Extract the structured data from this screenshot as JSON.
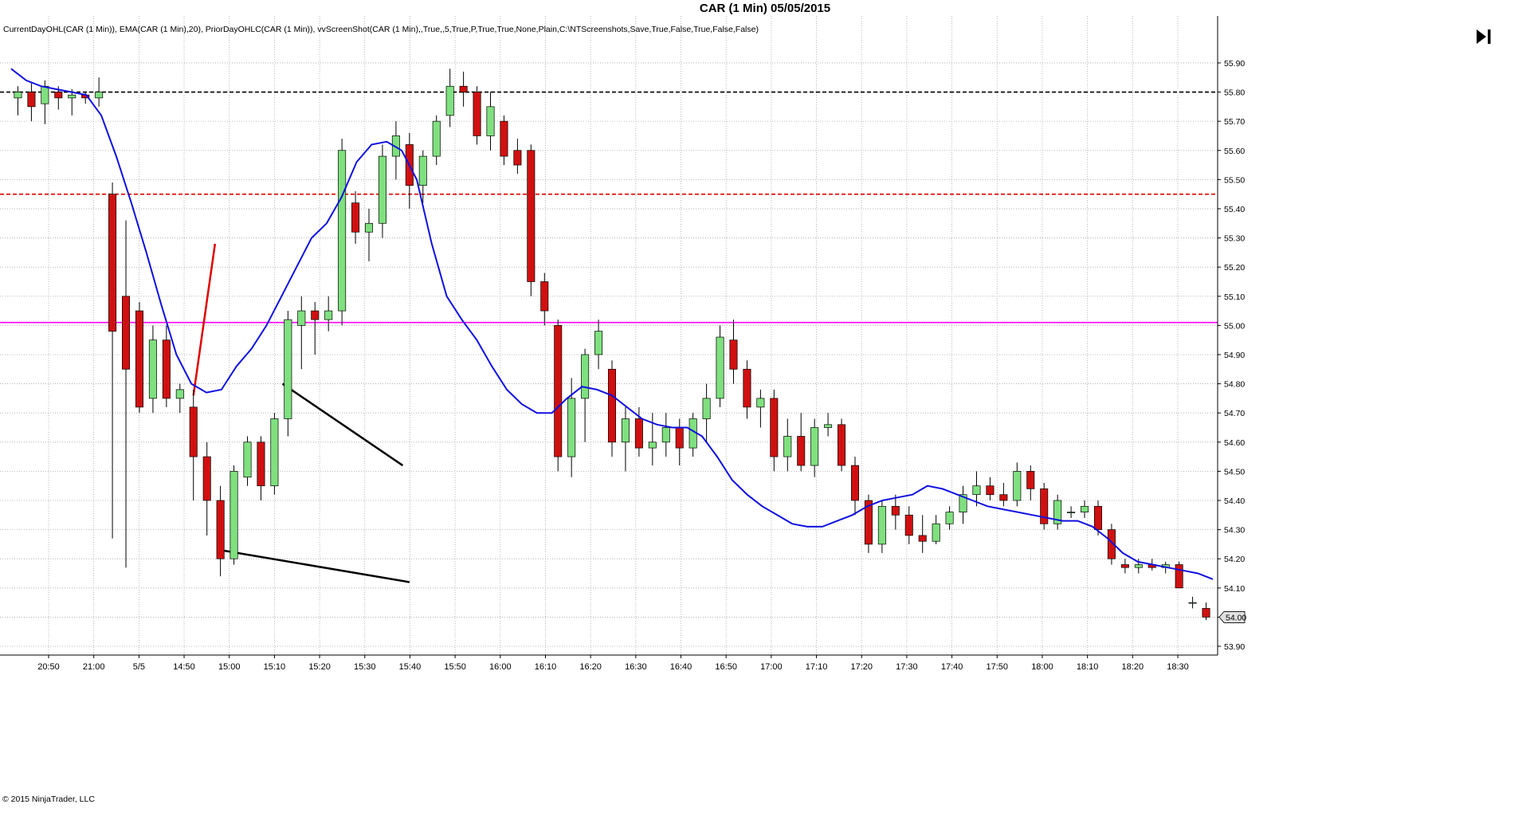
{
  "title": "CAR (1 Min)  05/05/2015",
  "indicators_label": "CurrentDayOHL(CAR (1 Min)), EMA(CAR (1 Min),20), PriorDayOHLC(CAR (1 Min)), vvScreenShot(CAR (1 Min),,True,,5,True,P,True,True,None,Plain,C:\\NTScreenshots,Save,True,False,True,False,False)",
  "copyright": "© 2015 NinjaTrader, LLC",
  "icons": {
    "scroll_to_end": "skip-to-end-icon"
  },
  "colors": {
    "up_candle": "#7fe07f",
    "down_candle": "#d01010",
    "ema": "#1010e0",
    "prior_high": "#000000",
    "current_high": "#e00000",
    "pivot": "#ff00ff",
    "grid": "#a8a8a8"
  },
  "chart_data": {
    "type": "candlestick",
    "title": "CAR (1 Min)  05/05/2015",
    "ylim": [
      53.87,
      55.99
    ],
    "y_ticks": [
      "55.90",
      "55.80",
      "55.70",
      "55.60",
      "55.50",
      "55.40",
      "55.30",
      "55.20",
      "55.10",
      "55.00",
      "54.90",
      "54.80",
      "54.70",
      "54.60",
      "54.50",
      "54.40",
      "54.30",
      "54.20",
      "54.10",
      "54.00",
      "53.90"
    ],
    "x_ticks": [
      "20:50",
      "21:00",
      "5/5",
      "14:50",
      "15:00",
      "15:10",
      "15:20",
      "15:30",
      "15:40",
      "15:50",
      "16:00",
      "16:10",
      "16:20",
      "16:30",
      "16:40",
      "16:50",
      "17:00",
      "17:10",
      "17:20",
      "17:30",
      "17:40",
      "17:50",
      "18:00",
      "18:10",
      "18:20",
      "18:30"
    ],
    "last_price": "54.00",
    "horizontal_lines": [
      {
        "y": 55.8,
        "style": "dashed",
        "color": "#000000"
      },
      {
        "y": 55.45,
        "style": "dashed",
        "color": "#e00000"
      },
      {
        "y": 55.01,
        "style": "solid",
        "color": "#ff00ff"
      }
    ],
    "ema_series": [
      55.88,
      55.84,
      55.82,
      55.81,
      55.8,
      55.79,
      55.72,
      55.58,
      55.42,
      55.25,
      55.07,
      54.9,
      54.8,
      54.77,
      54.78,
      54.86,
      54.92,
      55.0,
      55.1,
      55.2,
      55.3,
      55.35,
      55.44,
      55.56,
      55.62,
      55.63,
      55.6,
      55.5,
      55.28,
      55.1,
      55.02,
      54.95,
      54.86,
      54.78,
      54.73,
      54.7,
      54.7,
      54.75,
      54.79,
      54.78,
      54.76,
      54.72,
      54.68,
      54.66,
      54.65,
      54.65,
      54.62,
      54.55,
      54.47,
      54.42,
      54.38,
      54.35,
      54.32,
      54.31,
      54.31,
      54.33,
      54.35,
      54.38,
      54.4,
      54.41,
      54.42,
      54.45,
      54.44,
      54.42,
      54.4,
      54.38,
      54.37,
      54.36,
      54.35,
      54.34,
      54.33,
      54.33,
      54.31,
      54.27,
      54.22,
      54.19,
      54.18,
      54.17,
      54.16,
      54.15,
      54.13
    ],
    "candles": [
      {
        "x": 0,
        "o": 55.78,
        "h": 55.82,
        "l": 55.72,
        "c": 55.8
      },
      {
        "x": 1,
        "o": 55.8,
        "h": 55.83,
        "l": 55.7,
        "c": 55.75
      },
      {
        "x": 2,
        "o": 55.76,
        "h": 55.84,
        "l": 55.69,
        "c": 55.82
      },
      {
        "x": 3,
        "o": 55.8,
        "h": 55.82,
        "l": 55.74,
        "c": 55.78
      },
      {
        "x": 4,
        "o": 55.78,
        "h": 55.81,
        "l": 55.72,
        "c": 55.79
      },
      {
        "x": 5,
        "o": 55.79,
        "h": 55.8,
        "l": 55.76,
        "c": 55.78
      },
      {
        "x": 6,
        "o": 55.78,
        "h": 55.85,
        "l": 55.75,
        "c": 55.8
      },
      {
        "x": 7,
        "o": 55.45,
        "h": 55.49,
        "l": 54.27,
        "c": 54.98
      },
      {
        "x": 8,
        "o": 55.1,
        "h": 55.36,
        "l": 54.17,
        "c": 54.85
      },
      {
        "x": 9,
        "o": 55.05,
        "h": 55.08,
        "l": 54.7,
        "c": 54.72
      },
      {
        "x": 10,
        "o": 54.75,
        "h": 55.0,
        "l": 54.7,
        "c": 54.95
      },
      {
        "x": 11,
        "o": 54.95,
        "h": 55.0,
        "l": 54.72,
        "c": 54.75
      },
      {
        "x": 12,
        "o": 54.75,
        "h": 54.8,
        "l": 54.7,
        "c": 54.78
      },
      {
        "x": 13,
        "o": 54.72,
        "h": 54.78,
        "l": 54.4,
        "c": 54.55
      },
      {
        "x": 14,
        "o": 54.55,
        "h": 54.6,
        "l": 54.28,
        "c": 54.4
      },
      {
        "x": 15,
        "o": 54.4,
        "h": 54.45,
        "l": 54.14,
        "c": 54.2
      },
      {
        "x": 16,
        "o": 54.2,
        "h": 54.52,
        "l": 54.18,
        "c": 54.5
      },
      {
        "x": 17,
        "o": 54.48,
        "h": 54.62,
        "l": 54.45,
        "c": 54.6
      },
      {
        "x": 18,
        "o": 54.6,
        "h": 54.62,
        "l": 54.4,
        "c": 54.45
      },
      {
        "x": 19,
        "o": 54.45,
        "h": 54.7,
        "l": 54.42,
        "c": 54.68
      },
      {
        "x": 20,
        "o": 54.68,
        "h": 55.05,
        "l": 54.62,
        "c": 55.02
      },
      {
        "x": 21,
        "o": 55.0,
        "h": 55.1,
        "l": 54.85,
        "c": 55.05
      },
      {
        "x": 22,
        "o": 55.05,
        "h": 55.08,
        "l": 54.9,
        "c": 55.02
      },
      {
        "x": 23,
        "o": 55.02,
        "h": 55.1,
        "l": 54.98,
        "c": 55.05
      },
      {
        "x": 24,
        "o": 55.05,
        "h": 55.64,
        "l": 55.0,
        "c": 55.6
      },
      {
        "x": 25,
        "o": 55.42,
        "h": 55.46,
        "l": 55.28,
        "c": 55.32
      },
      {
        "x": 26,
        "o": 55.32,
        "h": 55.4,
        "l": 55.22,
        "c": 55.35
      },
      {
        "x": 27,
        "o": 55.35,
        "h": 55.62,
        "l": 55.3,
        "c": 55.58
      },
      {
        "x": 28,
        "o": 55.58,
        "h": 55.7,
        "l": 55.5,
        "c": 55.65
      },
      {
        "x": 29,
        "o": 55.62,
        "h": 55.66,
        "l": 55.4,
        "c": 55.48
      },
      {
        "x": 30,
        "o": 55.48,
        "h": 55.6,
        "l": 55.42,
        "c": 55.58
      },
      {
        "x": 31,
        "o": 55.58,
        "h": 55.72,
        "l": 55.55,
        "c": 55.7
      },
      {
        "x": 32,
        "o": 55.72,
        "h": 55.88,
        "l": 55.68,
        "c": 55.82
      },
      {
        "x": 33,
        "o": 55.82,
        "h": 55.87,
        "l": 55.75,
        "c": 55.8
      },
      {
        "x": 34,
        "o": 55.8,
        "h": 55.82,
        "l": 55.62,
        "c": 55.65
      },
      {
        "x": 35,
        "o": 55.65,
        "h": 55.8,
        "l": 55.6,
        "c": 55.75
      },
      {
        "x": 36,
        "o": 55.7,
        "h": 55.72,
        "l": 55.55,
        "c": 55.58
      },
      {
        "x": 37,
        "o": 55.6,
        "h": 55.64,
        "l": 55.52,
        "c": 55.55
      },
      {
        "x": 38,
        "o": 55.6,
        "h": 55.62,
        "l": 55.1,
        "c": 55.15
      },
      {
        "x": 39,
        "o": 55.15,
        "h": 55.18,
        "l": 55.0,
        "c": 55.05
      },
      {
        "x": 40,
        "o": 55.0,
        "h": 55.02,
        "l": 54.5,
        "c": 54.55
      },
      {
        "x": 41,
        "o": 54.55,
        "h": 54.82,
        "l": 54.48,
        "c": 54.75
      },
      {
        "x": 42,
        "o": 54.75,
        "h": 54.92,
        "l": 54.6,
        "c": 54.9
      },
      {
        "x": 43,
        "o": 54.9,
        "h": 55.02,
        "l": 54.85,
        "c": 54.98
      },
      {
        "x": 44,
        "o": 54.85,
        "h": 54.88,
        "l": 54.55,
        "c": 54.6
      },
      {
        "x": 45,
        "o": 54.6,
        "h": 54.72,
        "l": 54.5,
        "c": 54.68
      },
      {
        "x": 46,
        "o": 54.68,
        "h": 54.72,
        "l": 54.55,
        "c": 54.58
      },
      {
        "x": 47,
        "o": 54.58,
        "h": 54.7,
        "l": 54.52,
        "c": 54.6
      },
      {
        "x": 48,
        "o": 54.6,
        "h": 54.7,
        "l": 54.55,
        "c": 54.65
      },
      {
        "x": 49,
        "o": 54.65,
        "h": 54.68,
        "l": 54.52,
        "c": 54.58
      },
      {
        "x": 50,
        "o": 54.58,
        "h": 54.7,
        "l": 54.55,
        "c": 54.68
      },
      {
        "x": 51,
        "o": 54.68,
        "h": 54.8,
        "l": 54.6,
        "c": 54.75
      },
      {
        "x": 52,
        "o": 54.75,
        "h": 55.0,
        "l": 54.72,
        "c": 54.96
      },
      {
        "x": 53,
        "o": 54.95,
        "h": 55.02,
        "l": 54.8,
        "c": 54.85
      },
      {
        "x": 54,
        "o": 54.85,
        "h": 54.88,
        "l": 54.68,
        "c": 54.72
      },
      {
        "x": 55,
        "o": 54.72,
        "h": 54.78,
        "l": 54.65,
        "c": 54.75
      },
      {
        "x": 56,
        "o": 54.75,
        "h": 54.78,
        "l": 54.5,
        "c": 54.55
      },
      {
        "x": 57,
        "o": 54.55,
        "h": 54.68,
        "l": 54.5,
        "c": 54.62
      },
      {
        "x": 58,
        "o": 54.62,
        "h": 54.7,
        "l": 54.5,
        "c": 54.52
      },
      {
        "x": 59,
        "o": 54.52,
        "h": 54.68,
        "l": 54.48,
        "c": 54.65
      },
      {
        "x": 60,
        "o": 54.65,
        "h": 54.7,
        "l": 54.62,
        "c": 54.66
      },
      {
        "x": 61,
        "o": 54.66,
        "h": 54.68,
        "l": 54.5,
        "c": 54.52
      },
      {
        "x": 62,
        "o": 54.52,
        "h": 54.55,
        "l": 54.35,
        "c": 54.4
      },
      {
        "x": 63,
        "o": 54.4,
        "h": 54.42,
        "l": 54.22,
        "c": 54.25
      },
      {
        "x": 64,
        "o": 54.25,
        "h": 54.4,
        "l": 54.22,
        "c": 54.38
      },
      {
        "x": 65,
        "o": 54.38,
        "h": 54.42,
        "l": 54.3,
        "c": 54.35
      },
      {
        "x": 66,
        "o": 54.35,
        "h": 54.38,
        "l": 54.25,
        "c": 54.28
      },
      {
        "x": 67,
        "o": 54.28,
        "h": 54.35,
        "l": 54.22,
        "c": 54.26
      },
      {
        "x": 68,
        "o": 54.26,
        "h": 54.35,
        "l": 54.25,
        "c": 54.32
      },
      {
        "x": 69,
        "o": 54.32,
        "h": 54.38,
        "l": 54.3,
        "c": 54.36
      },
      {
        "x": 70,
        "o": 54.36,
        "h": 54.45,
        "l": 54.32,
        "c": 54.42
      },
      {
        "x": 71,
        "o": 54.42,
        "h": 54.5,
        "l": 54.38,
        "c": 54.45
      },
      {
        "x": 72,
        "o": 54.45,
        "h": 54.48,
        "l": 54.4,
        "c": 54.42
      },
      {
        "x": 73,
        "o": 54.42,
        "h": 54.46,
        "l": 54.38,
        "c": 54.4
      },
      {
        "x": 74,
        "o": 54.4,
        "h": 54.53,
        "l": 54.38,
        "c": 54.5
      },
      {
        "x": 75,
        "o": 54.5,
        "h": 54.52,
        "l": 54.4,
        "c": 54.44
      },
      {
        "x": 76,
        "o": 54.44,
        "h": 54.46,
        "l": 54.3,
        "c": 54.32
      },
      {
        "x": 77,
        "o": 54.32,
        "h": 54.42,
        "l": 54.3,
        "c": 54.4
      },
      {
        "x": 78,
        "o": 54.36,
        "h": 54.38,
        "l": 54.34,
        "c": 54.36
      },
      {
        "x": 79,
        "o": 54.36,
        "h": 54.4,
        "l": 54.34,
        "c": 54.38
      },
      {
        "x": 80,
        "o": 54.38,
        "h": 54.4,
        "l": 54.28,
        "c": 54.3
      },
      {
        "x": 81,
        "o": 54.3,
        "h": 54.32,
        "l": 54.18,
        "c": 54.2
      },
      {
        "x": 82,
        "o": 54.18,
        "h": 54.2,
        "l": 54.15,
        "c": 54.17
      },
      {
        "x": 83,
        "o": 54.17,
        "h": 54.2,
        "l": 54.15,
        "c": 54.18
      },
      {
        "x": 84,
        "o": 54.18,
        "h": 54.2,
        "l": 54.16,
        "c": 54.17
      },
      {
        "x": 85,
        "o": 54.17,
        "h": 54.19,
        "l": 54.15,
        "c": 54.18
      },
      {
        "x": 86,
        "o": 54.18,
        "h": 54.19,
        "l": 54.1,
        "c": 54.1
      },
      {
        "x": 87,
        "o": 54.05,
        "h": 54.07,
        "l": 54.03,
        "c": 54.05
      },
      {
        "x": 88,
        "o": 54.03,
        "h": 54.05,
        "l": 53.99,
        "c": 54.0
      }
    ],
    "trend_lines": [
      {
        "color": "#e00000",
        "from": {
          "x": 13,
          "y": 54.76
        },
        "to": {
          "x": 14.6,
          "y": 55.28
        }
      },
      {
        "color": "#000000",
        "from": {
          "x": 19.6,
          "y": 54.8
        },
        "to": {
          "x": 28.5,
          "y": 54.52
        }
      },
      {
        "color": "#000000",
        "from": {
          "x": 15.0,
          "y": 54.23
        },
        "to": {
          "x": 29.0,
          "y": 54.12
        }
      }
    ]
  }
}
